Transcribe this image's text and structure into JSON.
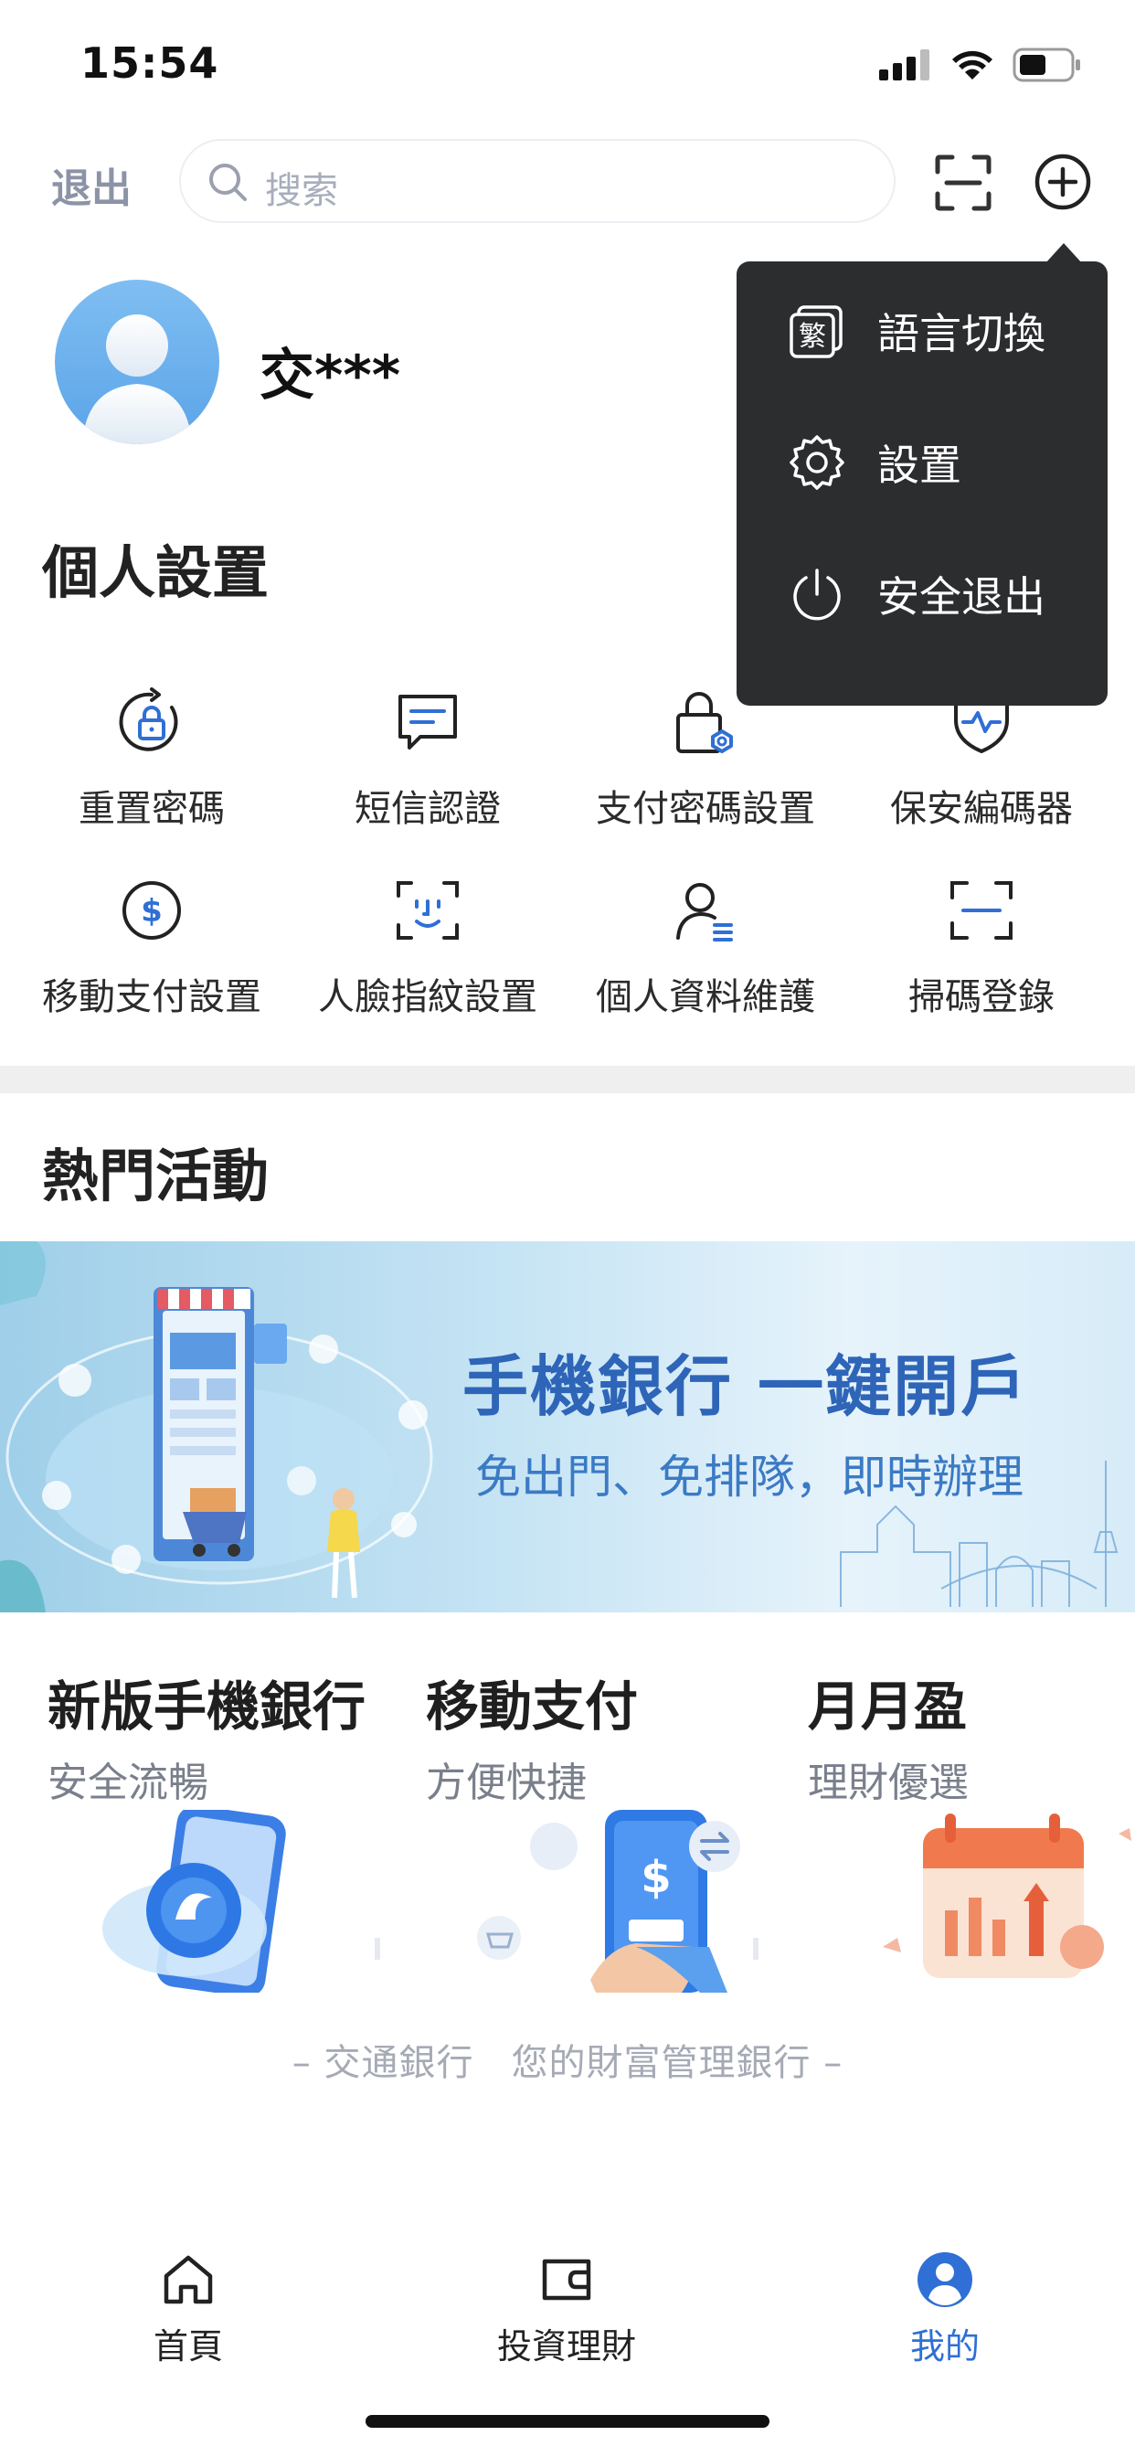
{
  "status_bar": {
    "time": "15:54"
  },
  "top_bar": {
    "exit_label": "退出",
    "search_placeholder": "搜索"
  },
  "profile": {
    "name": "交***"
  },
  "personal_settings": {
    "title": "個人設置",
    "items": [
      {
        "label": "重置密碼",
        "icon": "reset-lock-icon"
      },
      {
        "label": "短信認證",
        "icon": "sms-icon"
      },
      {
        "label": "支付密碼設置",
        "icon": "payment-lock-icon"
      },
      {
        "label": "保安編碼器",
        "icon": "security-token-icon"
      },
      {
        "label": "移動支付設置",
        "icon": "dollar-circle-icon"
      },
      {
        "label": "人臉指紋設置",
        "icon": "face-id-icon"
      },
      {
        "label": "個人資料維護",
        "icon": "profile-icon"
      },
      {
        "label": "掃碼登錄",
        "icon": "scan-icon"
      }
    ]
  },
  "hot_events": {
    "title": "熱門活動",
    "banner": {
      "title": "手機銀行 一鍵開戶",
      "subtitle": "免出門、免排隊，即時辦理"
    }
  },
  "products": [
    {
      "title": "新版手機銀行",
      "subtitle": "安全流暢"
    },
    {
      "title": "移動支付",
      "subtitle": "方便快捷"
    },
    {
      "title": "月月盈",
      "subtitle": "理財優選"
    }
  ],
  "slogan": "– 交通銀行　您的財富管理銀行 –",
  "tab_bar": {
    "tabs": [
      {
        "label": "首頁",
        "icon": "home-icon"
      },
      {
        "label": "投資理財",
        "icon": "wallet-icon"
      },
      {
        "label": "我的",
        "icon": "user-icon"
      }
    ],
    "active": "我的"
  },
  "dropdown_menu": {
    "items": [
      {
        "label": "語言切換",
        "icon": "language-icon",
        "icon_glyph": "繁"
      },
      {
        "label": "設置",
        "icon": "gear-icon"
      },
      {
        "label": "安全退出",
        "icon": "power-icon"
      }
    ]
  },
  "colors": {
    "accent": "#2f6fd6",
    "menu_bg": "#2c2d2f",
    "muted": "#8c93a6"
  }
}
